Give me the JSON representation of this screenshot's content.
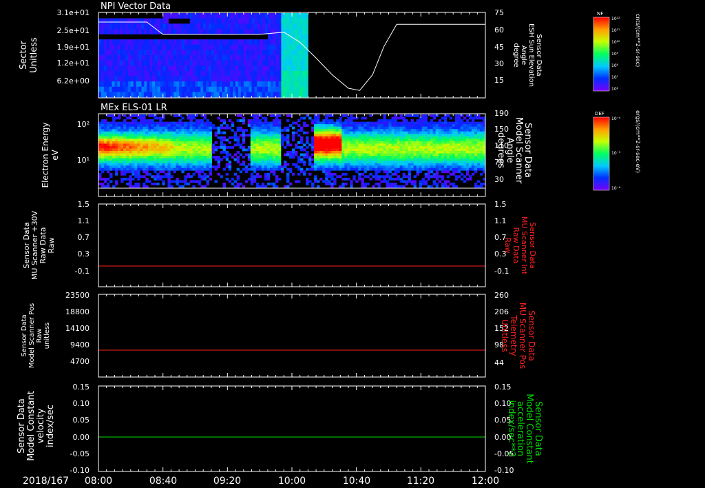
{
  "date_label": "2018/167",
  "x_ticks": [
    "08:00",
    "08:40",
    "09:20",
    "10:00",
    "10:40",
    "11:20",
    "12:00"
  ],
  "colors": {
    "background": "#000000",
    "axis": "#ffffff",
    "red_series": "#ff2020",
    "green_series": "#00e000"
  },
  "panels": [
    {
      "title": "NPI Vector Data",
      "left_label": [
        "Sector",
        "Unitless"
      ],
      "left_ticks": [
        "3.1e+01",
        "2.5e+01",
        "1.9e+01",
        "1.2e+01",
        "6.2e+00"
      ],
      "right_label": [
        "Sensor Data",
        "ESH Sun Elevation",
        "Angle",
        "degree"
      ],
      "right_ticks": [
        "75",
        "60",
        "45",
        "30",
        "15"
      ]
    },
    {
      "title": "MEx ELS-01 LR",
      "left_label": [
        "Electron Energy",
        "eV"
      ],
      "left_ticks": [
        "10²",
        "10¹"
      ],
      "right_label": [
        "Sensor Data",
        "Model Scanner",
        "Angle",
        "degrees"
      ],
      "right_ticks": [
        "190",
        "150",
        "110",
        "70",
        "30"
      ]
    },
    {
      "left_label": [
        "Sensor Data",
        "MU Scanner +30V",
        "Raw Data",
        "Raw"
      ],
      "left_ticks": [
        "1.5",
        "1.1",
        "0.7",
        "0.3",
        "-0.1"
      ],
      "right_label": [
        "Sensor Data",
        "MU Scanner Int",
        "Raw Data",
        "Raw"
      ],
      "right_ticks": [
        "1.5",
        "1.1",
        "0.7",
        "0.3",
        "-0.1"
      ]
    },
    {
      "left_label": [
        "Sensor Data",
        "Model Scanner Pos",
        "Raw",
        "unitless"
      ],
      "left_ticks": [
        "23500",
        "18800",
        "14100",
        "9400",
        "4700"
      ],
      "right_label": [
        "Sensor Data",
        "MU Scanner Pos",
        "Telemetry",
        "Unitless"
      ],
      "right_ticks": [
        "260",
        "206",
        "152",
        "98",
        "44"
      ]
    },
    {
      "left_label": [
        "Sensor Data",
        "Model Constant",
        "velocity",
        "index/sec"
      ],
      "left_ticks": [
        "0.15",
        "0.10",
        "0.05",
        "0.00",
        "-0.05",
        "-0.10"
      ],
      "right_label": [
        "Sensor Data",
        "Model Constant",
        "acceleration",
        "index/sec**2"
      ],
      "right_ticks": [
        "0.15",
        "0.10",
        "0.05",
        "0.00",
        "-0.05",
        "-0.10"
      ]
    }
  ],
  "colorbars": [
    {
      "label": "NF",
      "unit": "cnts/(cm**2-sr-sec)",
      "ticks": [
        "10¹²",
        "10¹¹",
        "10¹⁰",
        "10⁹",
        "10⁸",
        "10⁷",
        "10⁶"
      ]
    },
    {
      "label": "DEF",
      "unit": "ergs/(cm**2-sr-sec-eV)",
      "ticks": [
        "10⁻⁴",
        "10⁻⁵",
        "10⁻⁶"
      ]
    }
  ],
  "chart_data": [
    {
      "type": "line",
      "series": [
        {
          "x": [
            "08:00",
            "08:30",
            "08:40",
            "09:40",
            "09:55",
            "10:05",
            "10:15",
            "10:25",
            "10:35",
            "10:42",
            "10:50",
            "10:57",
            "11:05",
            "11:20",
            "12:00"
          ],
          "y": [
            67,
            67,
            56,
            56,
            58,
            49,
            35,
            20,
            8,
            6,
            20,
            45,
            65,
            65,
            65
          ]
        }
      ],
      "ylim": [
        0,
        75
      ],
      "xlim": [
        "08:00",
        "12:00"
      ]
    },
    {
      "type": "heatmap",
      "ylabel": "Electron Energy",
      "xlim": [
        "08:00",
        "12:00"
      ]
    },
    {
      "type": "line",
      "series": [
        {
          "x": [
            "08:00",
            "12:00"
          ],
          "y": [
            -0.1,
            -0.1
          ]
        }
      ],
      "ylim": [
        -0.3,
        1.5
      ]
    },
    {
      "type": "line",
      "series": [
        {
          "x": [
            "08:00",
            "12:00"
          ],
          "y": [
            9000,
            9000
          ]
        }
      ],
      "ylim": [
        0,
        23500
      ]
    },
    {
      "type": "line",
      "series": [
        {
          "x": [
            "08:00",
            "12:00"
          ],
          "y": [
            0.0,
            0.0
          ]
        }
      ],
      "ylim": [
        -0.1,
        0.15
      ]
    }
  ]
}
